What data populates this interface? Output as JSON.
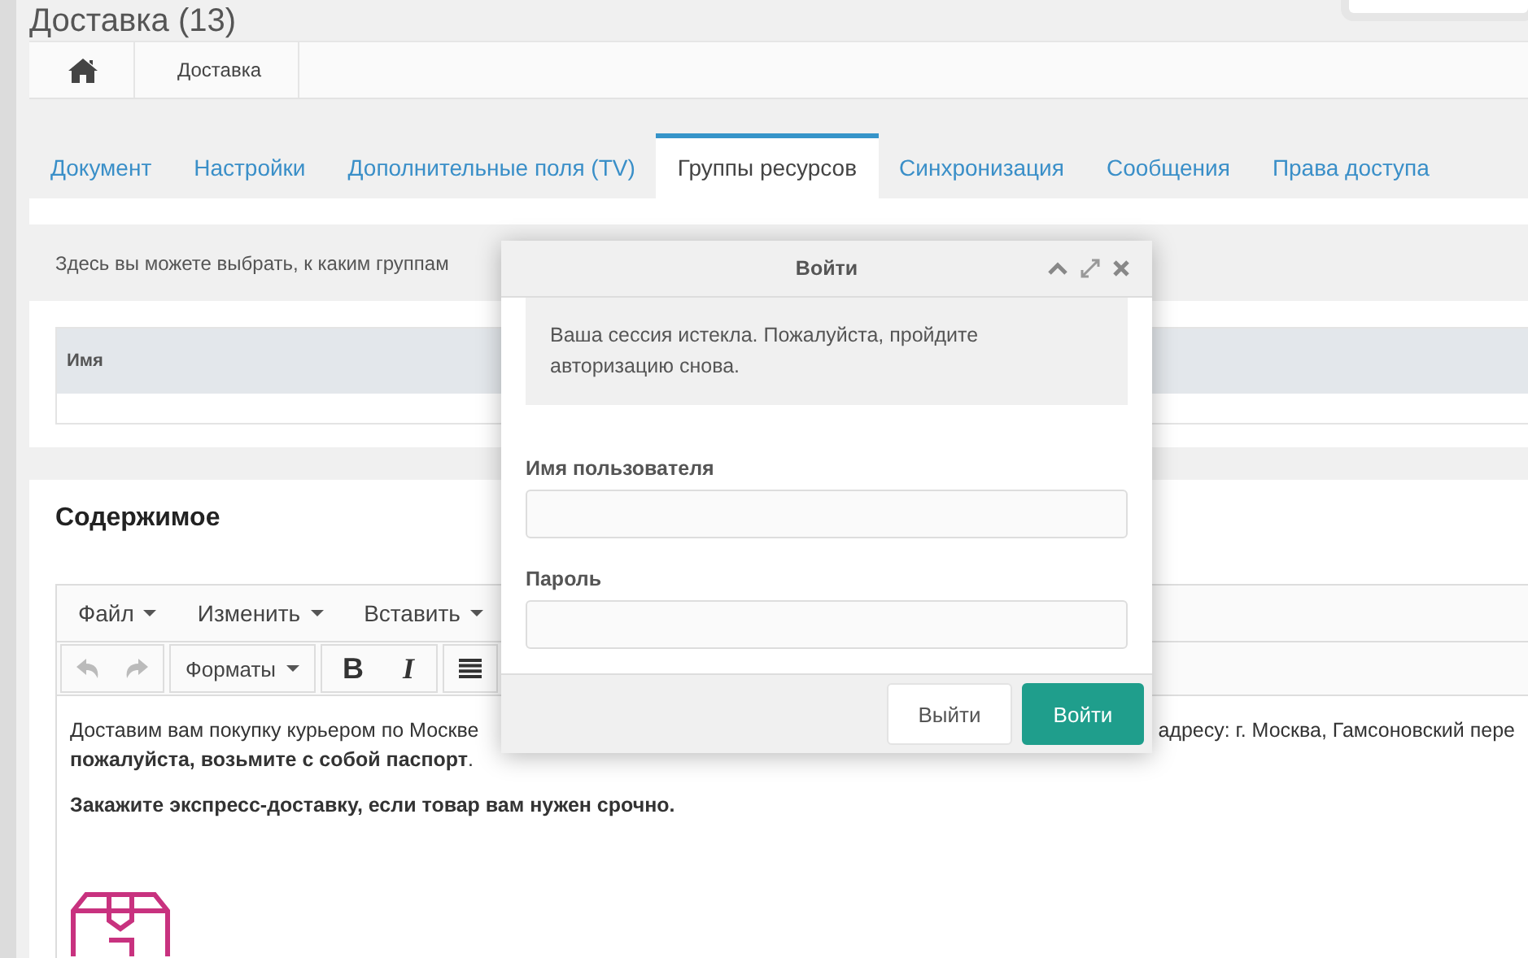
{
  "page_title": "Доставка (13)",
  "breadcrumb": [
    "Доставка"
  ],
  "tabs": [
    {
      "label": "Документ",
      "selected": false
    },
    {
      "label": "Настройки",
      "selected": false
    },
    {
      "label": "Дополнительные поля (TV)",
      "selected": false
    },
    {
      "label": "Группы ресурсов",
      "selected": true
    },
    {
      "label": "Синхронизация",
      "selected": false
    },
    {
      "label": "Сообщения",
      "selected": false
    },
    {
      "label": "Права доступа",
      "selected": false
    }
  ],
  "resource_groups": {
    "info": "Здесь вы можете выбрать, к каким группам",
    "column_1": "Имя"
  },
  "content_panel": {
    "title": "Содержимое",
    "menu": [
      "Файл",
      "Изменить",
      "Вставить"
    ],
    "format_menu": "Форматы",
    "bold_button": "B",
    "italic_button": "I",
    "body_text": [
      {
        "kind": "split",
        "left": "Доставим вам покупку курьером по Москве",
        "right": "адресу: г. Москва, Гамсоновский пере"
      },
      {
        "kind": "rich",
        "text": "**пожалуйста, возьмите с собой паспорт**."
      },
      {
        "kind": "bold",
        "text": "Закажите экспресс-доставку, если товар вам нужен срочно."
      }
    ]
  },
  "login_dialog": {
    "title": "Войти",
    "message": "Ваша сессия истекла. Пожалуйста, пройдите авторизацию снова.",
    "fields": [
      {
        "label": "Имя пользователя"
      },
      {
        "label": "Пароль"
      }
    ],
    "buttons": [
      {
        "label": "Выйти",
        "kind": "secondary"
      },
      {
        "label": "Войти",
        "kind": "primary"
      }
    ]
  }
}
